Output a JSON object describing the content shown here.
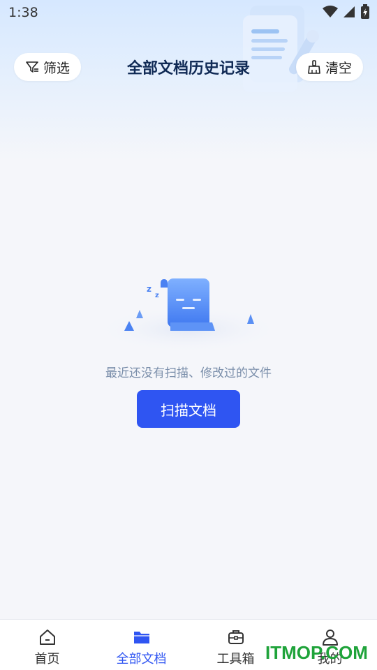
{
  "status_bar": {
    "time": "1:38"
  },
  "header": {
    "title": "全部文档历史记录",
    "filter_label": "筛选",
    "clear_label": "清空"
  },
  "empty_state": {
    "message": "最近还没有扫描、修改过的文件",
    "scan_button_label": "扫描文档"
  },
  "bottom_nav": {
    "items": [
      {
        "label": "首页",
        "icon": "home-icon",
        "active": false
      },
      {
        "label": "全部文档",
        "icon": "folder-icon",
        "active": true
      },
      {
        "label": "工具箱",
        "icon": "toolbox-icon",
        "active": false
      },
      {
        "label": "我的",
        "icon": "person-icon",
        "active": false
      }
    ]
  },
  "watermark": "ITMOP.COM",
  "colors": {
    "accent": "#2f55f2",
    "title": "#102a55",
    "watermark": "#1fa33a"
  }
}
